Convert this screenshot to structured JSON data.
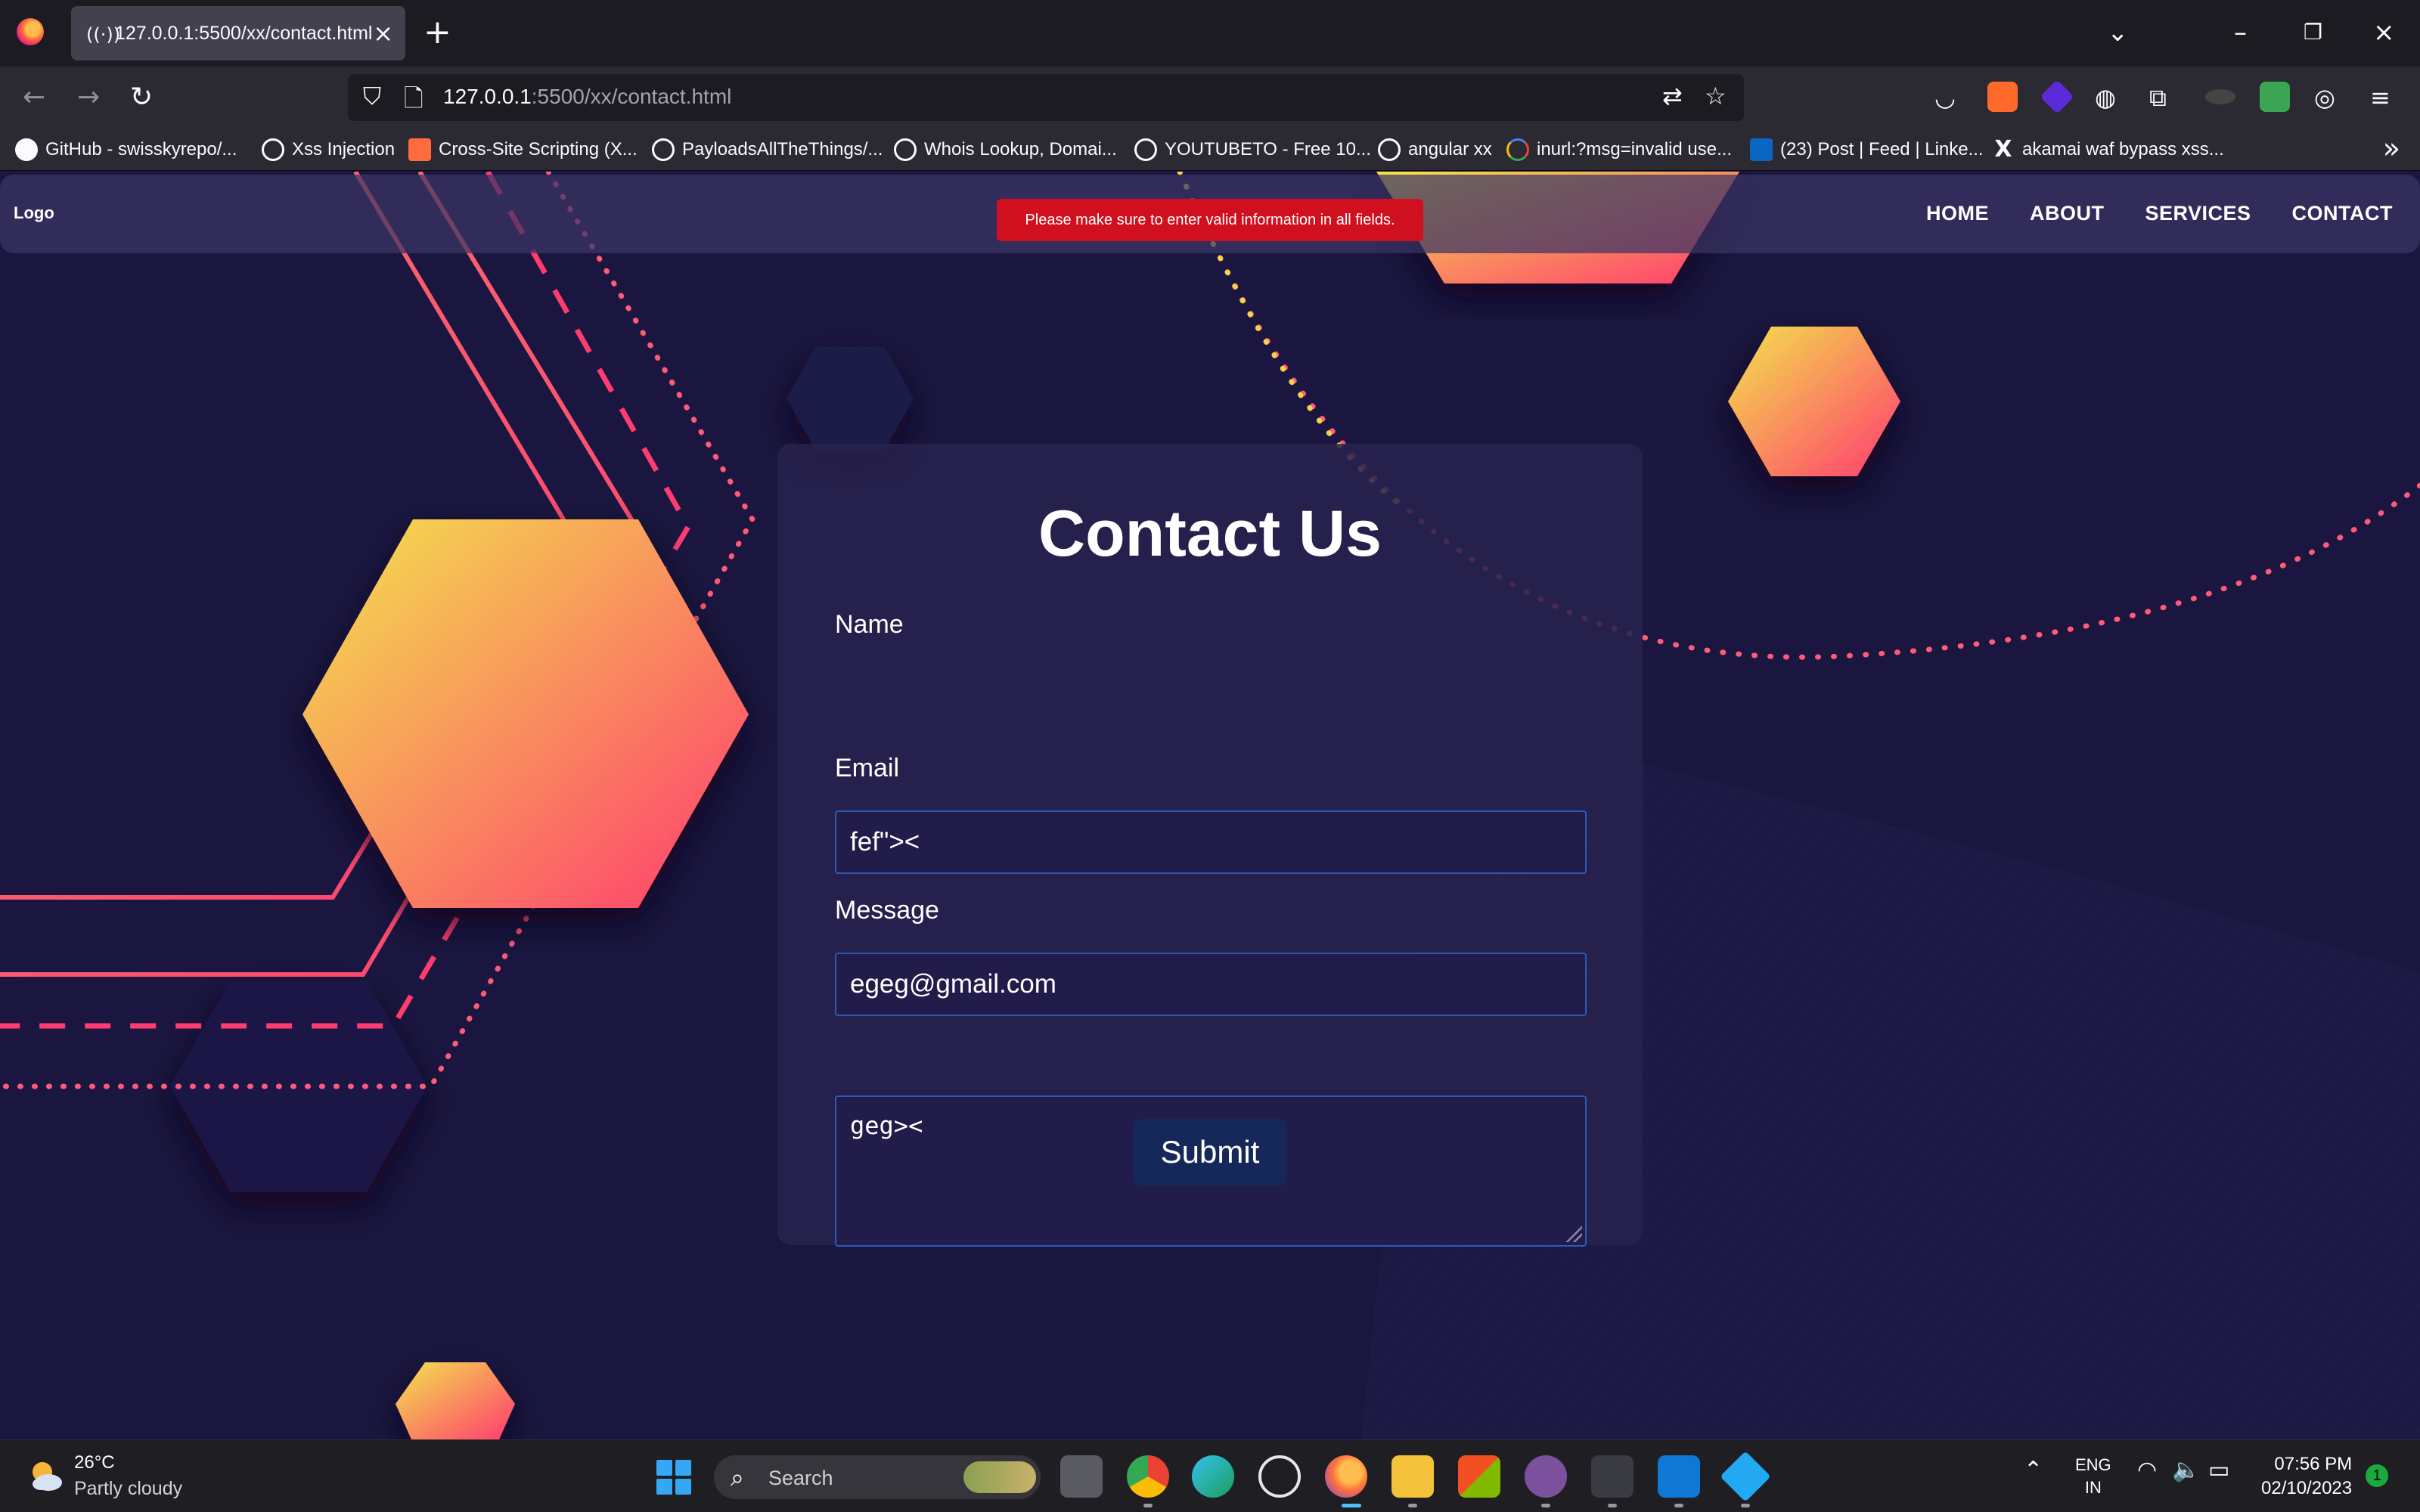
{
  "browser": {
    "tab_title": "127.0.0.1:5500/xx/contact.html",
    "url_host": "127.0.0.1",
    "url_path": ":5500/xx/contact.html",
    "bookmarks": [
      "GitHub - swisskyrepo/...",
      "Xss Injection",
      "Cross-Site Scripting (X...",
      "PayloadsAllTheThings/...",
      "Whois Lookup, Domai...",
      "YOUTUBETO - Free 10...",
      "angular xx",
      "inurl:?msg=invalid use...",
      "(23) Post | Feed | Linke...",
      "akamai waf bypass xss..."
    ]
  },
  "site": {
    "logo": "Logo",
    "menu": [
      "HOME",
      "ABOUT",
      "SERVICES",
      "CONTACT"
    ],
    "alert": "Please make sure to enter valid information in all fields."
  },
  "form": {
    "title": "Contact Us",
    "name_label": "Name",
    "name_value": "fef\"><",
    "email_label": "Email",
    "email_value": "egeg@gmail.com",
    "message_label": "Message",
    "message_value": "geg><",
    "submit_label": "Submit"
  },
  "taskbar": {
    "temperature": "26°C",
    "weather": "Partly cloudy",
    "search_placeholder": "Search",
    "lang_1": "ENG",
    "lang_2": "IN",
    "time": "07:56 PM",
    "date": "02/10/2023",
    "notifications": "1"
  },
  "icons": {
    "back": "arrow-left-icon",
    "forward": "arrow-right-icon",
    "reload": "reload-icon",
    "tracking_protection": "shield-icon",
    "translate": "translate-icon",
    "bookmark_star": "star-icon",
    "pocket": "pocket-icon",
    "menu": "hamburger-icon"
  },
  "colors": {
    "page_bg": "#1b1640",
    "accent_gradient_start": "#f3e44c",
    "accent_gradient_end": "#ff3b6f",
    "alert_bg": "#d0101e",
    "submit_bg": "#16275a",
    "input_border": "#2a5ab8"
  }
}
